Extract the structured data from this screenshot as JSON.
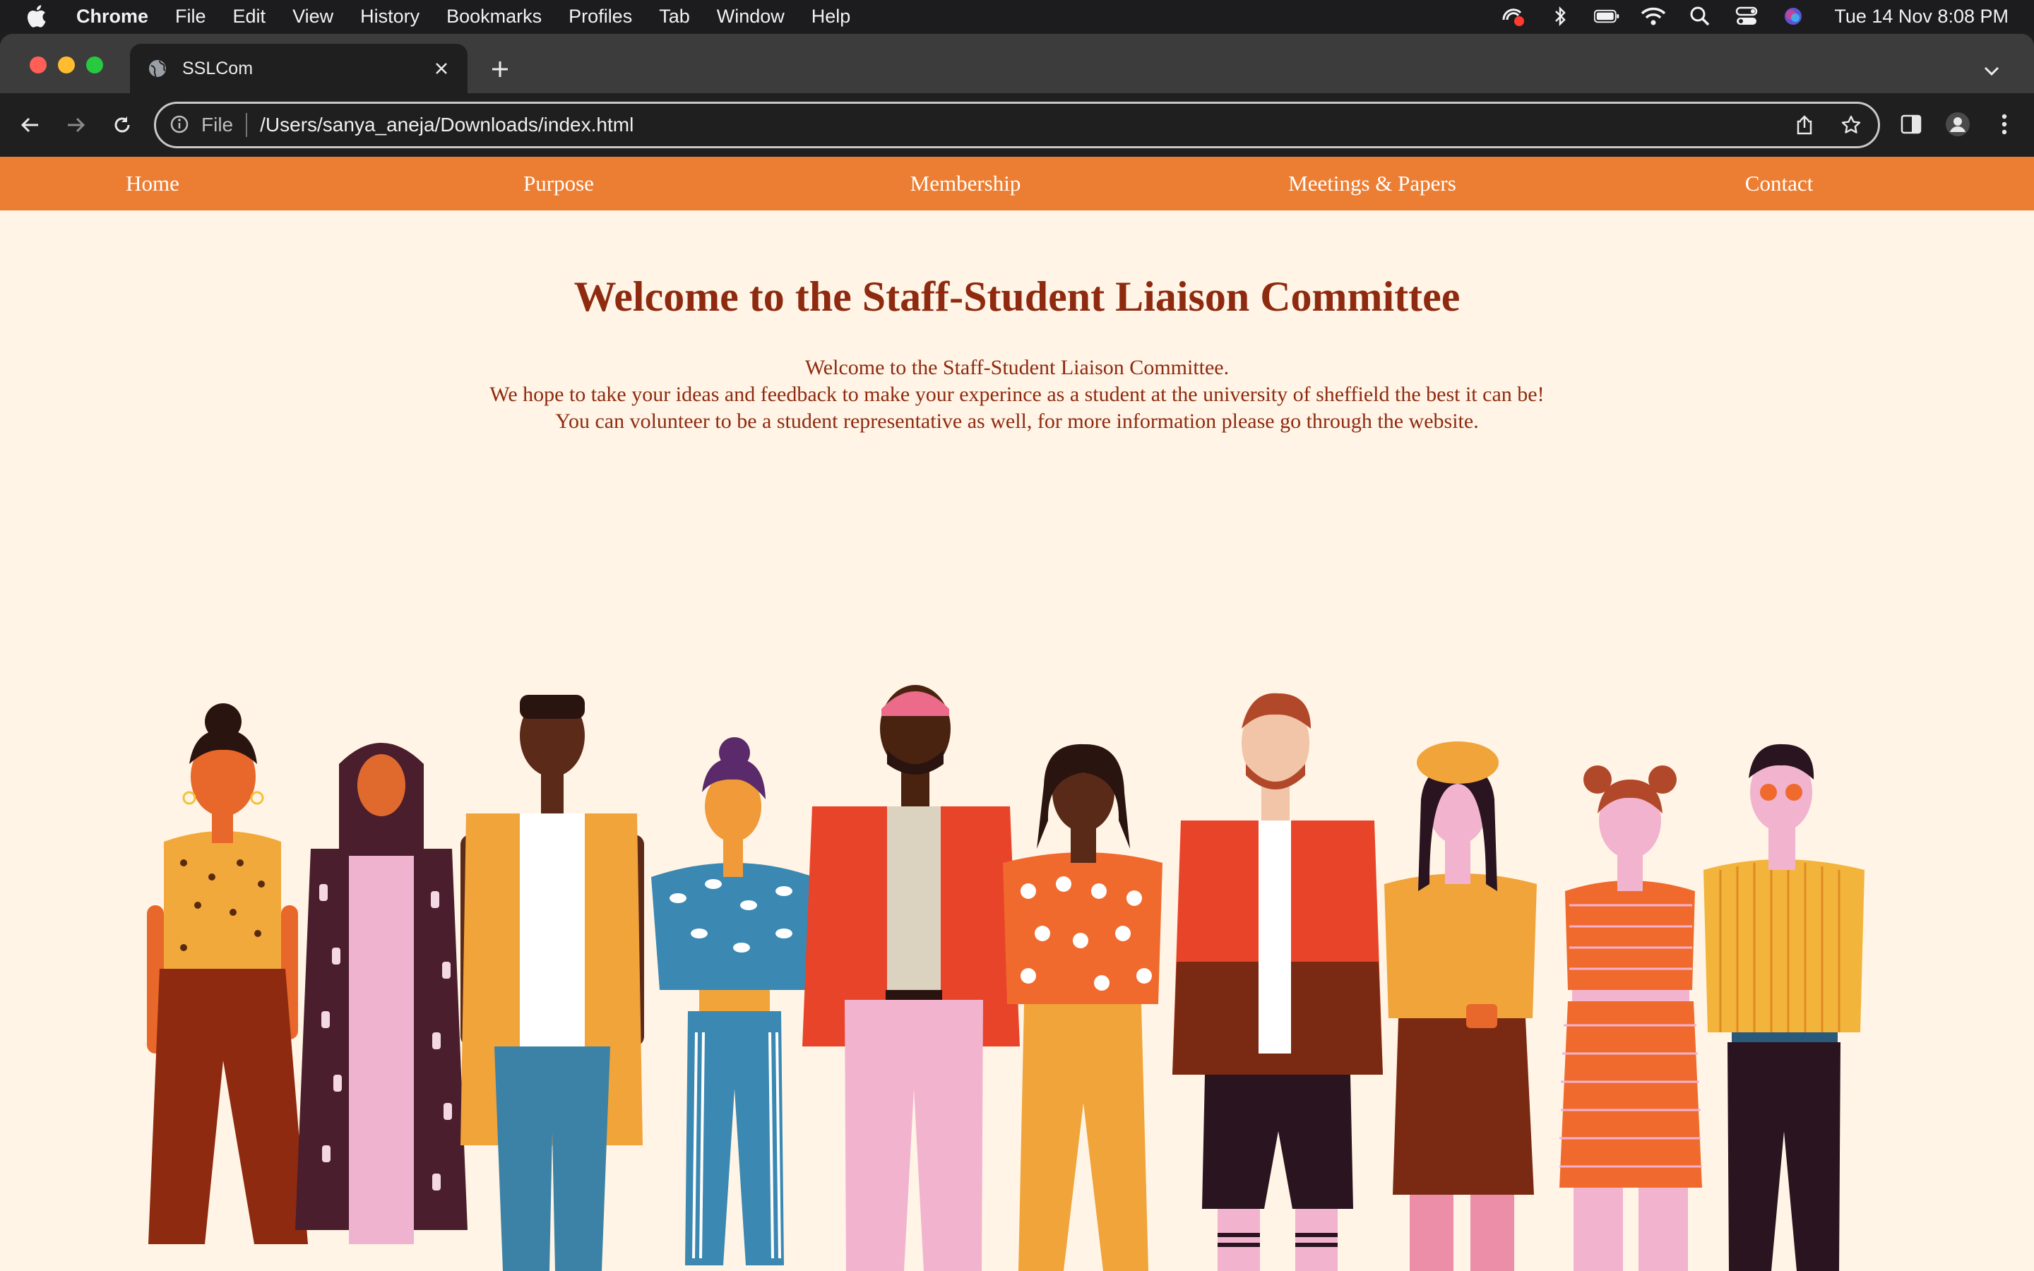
{
  "menubar": {
    "app_name": "Chrome",
    "items": [
      "File",
      "Edit",
      "View",
      "History",
      "Bookmarks",
      "Profiles",
      "Tab",
      "Window",
      "Help"
    ],
    "clock": "Tue 14 Nov  8:08 PM"
  },
  "browser": {
    "tab_title": "SSLCom",
    "address_scheme": "File",
    "address_url": "/Users/sanya_aneja/Downloads/index.html"
  },
  "site": {
    "nav": [
      "Home",
      "Purpose",
      "Membership",
      "Meetings & Papers",
      "Contact"
    ],
    "heading": "Welcome to the Staff-Student Liaison Committee",
    "intro_lines": [
      "Welcome to the Staff-Student Liaison Committee.",
      "We hope to take your ideas and feedback to make your experince as a student at the university of sheffield the best it can be!",
      "You can volunteer to be a student representative as well, for more information please go through the website."
    ]
  },
  "colors": {
    "nav_bar": "#ec7e33",
    "page_background": "#fff4e5",
    "heading_text": "#8e2a10"
  }
}
